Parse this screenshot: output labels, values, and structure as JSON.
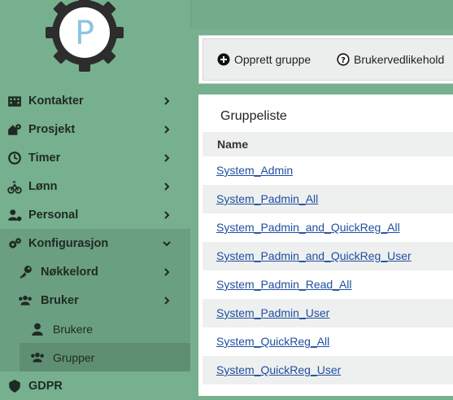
{
  "colors": {
    "sidebar": "#77b08f",
    "link": "#1f4ea1",
    "panel": "#ffffff",
    "row_alt": "#eef0ef"
  },
  "logo": {
    "letter": "P"
  },
  "sidebar": {
    "items": [
      {
        "label": "Kontakter",
        "icon": "building-icon"
      },
      {
        "label": "Prosjekt",
        "icon": "project-icon"
      },
      {
        "label": "Timer",
        "icon": "clock-icon"
      },
      {
        "label": "Lønn",
        "icon": "salary-icon"
      },
      {
        "label": "Personal",
        "icon": "users-cog-icon"
      },
      {
        "label": "Konfigurasjon",
        "icon": "cogs-icon"
      },
      {
        "label": "Nøkkelord",
        "icon": "key-icon"
      },
      {
        "label": "Bruker",
        "icon": "users-icon"
      },
      {
        "label": "Brukere",
        "icon": "user-icon"
      },
      {
        "label": "Grupper",
        "icon": "group-icon"
      },
      {
        "label": "GDPR",
        "icon": "gdpr-icon"
      }
    ]
  },
  "toolbar": {
    "create_label": "Opprett gruppe",
    "maintenance_label": "Brukervedlikehold"
  },
  "panel": {
    "title": "Gruppeliste",
    "column_name": "Name",
    "rows": [
      "System_Admin",
      "System_Padmin_All",
      "System_Padmin_and_QuickReg_All",
      "System_Padmin_and_QuickReg_User",
      "System_Padmin_Read_All",
      "System_Padmin_User",
      "System_QuickReg_All",
      "System_QuickReg_User"
    ]
  }
}
